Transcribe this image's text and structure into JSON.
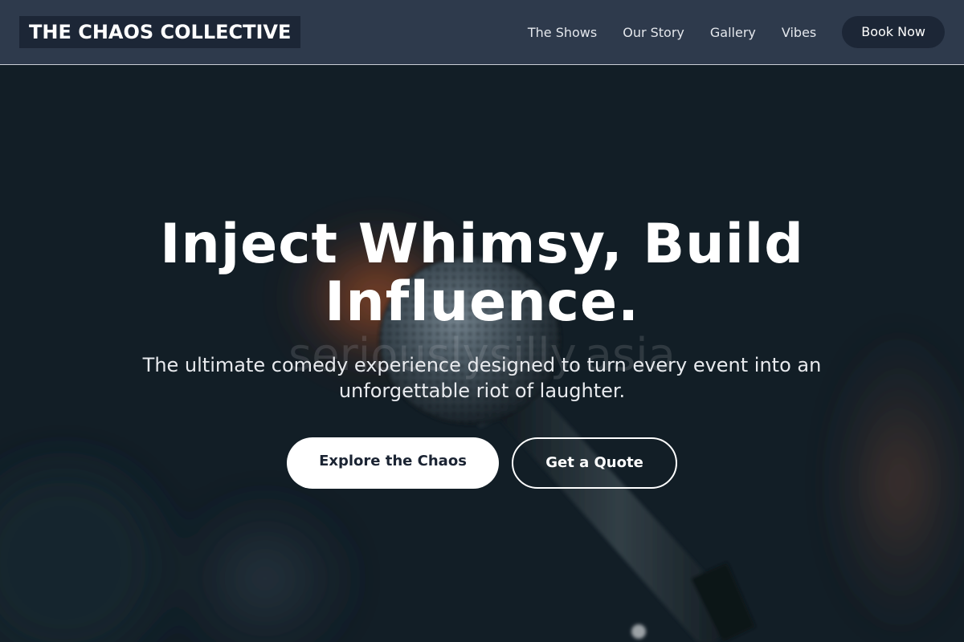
{
  "header": {
    "logo": "THE CHAOS COLLECTIVE",
    "nav": [
      {
        "label": "The Shows"
      },
      {
        "label": "Our Story"
      },
      {
        "label": "Gallery"
      },
      {
        "label": "Vibes"
      }
    ],
    "book_label": "Book Now"
  },
  "hero": {
    "headline": "Inject Whimsy, Build Influence.",
    "subheadline": "The ultimate comedy experience designed to turn every event into an unforgettable riot of laughter.",
    "watermark": "seriouslysilly.asia",
    "primary_cta": "Explore the Chaos",
    "secondary_cta": "Get a Quote",
    "photo_icon": "microphone-photo"
  },
  "colors": {
    "header_bg": "#2e3a4c",
    "logo_bg": "#1c2636",
    "hero_bg": "#131d26",
    "accent_warm": "#c05a2a",
    "text_light": "#ffffff"
  }
}
